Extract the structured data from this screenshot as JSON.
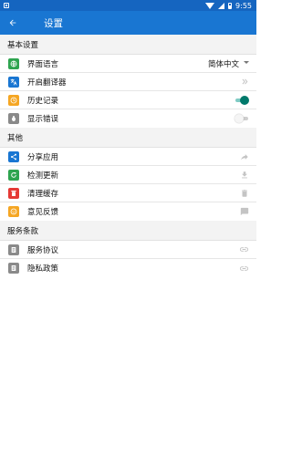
{
  "status_bar": {
    "time": "9:55"
  },
  "app_bar": {
    "title": "设置",
    "back_icon": "arrow-back-icon"
  },
  "sections": {
    "basic": {
      "title": "基本设置",
      "items": [
        {
          "label": "界面语言",
          "value": "简体中文",
          "icon": "globe-icon",
          "color": "#2ea44f"
        },
        {
          "label": "开启翻译器",
          "icon": "translate-icon",
          "color": "#1976d2"
        },
        {
          "label": "历史记录",
          "icon": "history-icon",
          "color": "#f5a623",
          "toggle": true
        },
        {
          "label": "显示错误",
          "icon": "bug-icon",
          "color": "#8a8a8a",
          "toggle": false
        }
      ]
    },
    "other": {
      "title": "其他",
      "items": [
        {
          "label": "分享应用",
          "icon": "share-icon",
          "color": "#1976d2"
        },
        {
          "label": "检测更新",
          "icon": "refresh-icon",
          "color": "#2ea44f"
        },
        {
          "label": "清理缓存",
          "icon": "trash-icon",
          "color": "#e53935"
        },
        {
          "label": "意见反馈",
          "icon": "smile-icon",
          "color": "#f5a623"
        }
      ]
    },
    "terms": {
      "title": "服务条款",
      "items": [
        {
          "label": "服务协议",
          "icon": "document-icon",
          "color": "#8a8a8a"
        },
        {
          "label": "隐私政策",
          "icon": "document-icon",
          "color": "#8a8a8a"
        }
      ]
    }
  },
  "colors": {
    "status_bar": "#1565c0",
    "app_bar": "#1976d2",
    "toggle_on": "#00796b",
    "section_bg": "#f3f3f3"
  }
}
